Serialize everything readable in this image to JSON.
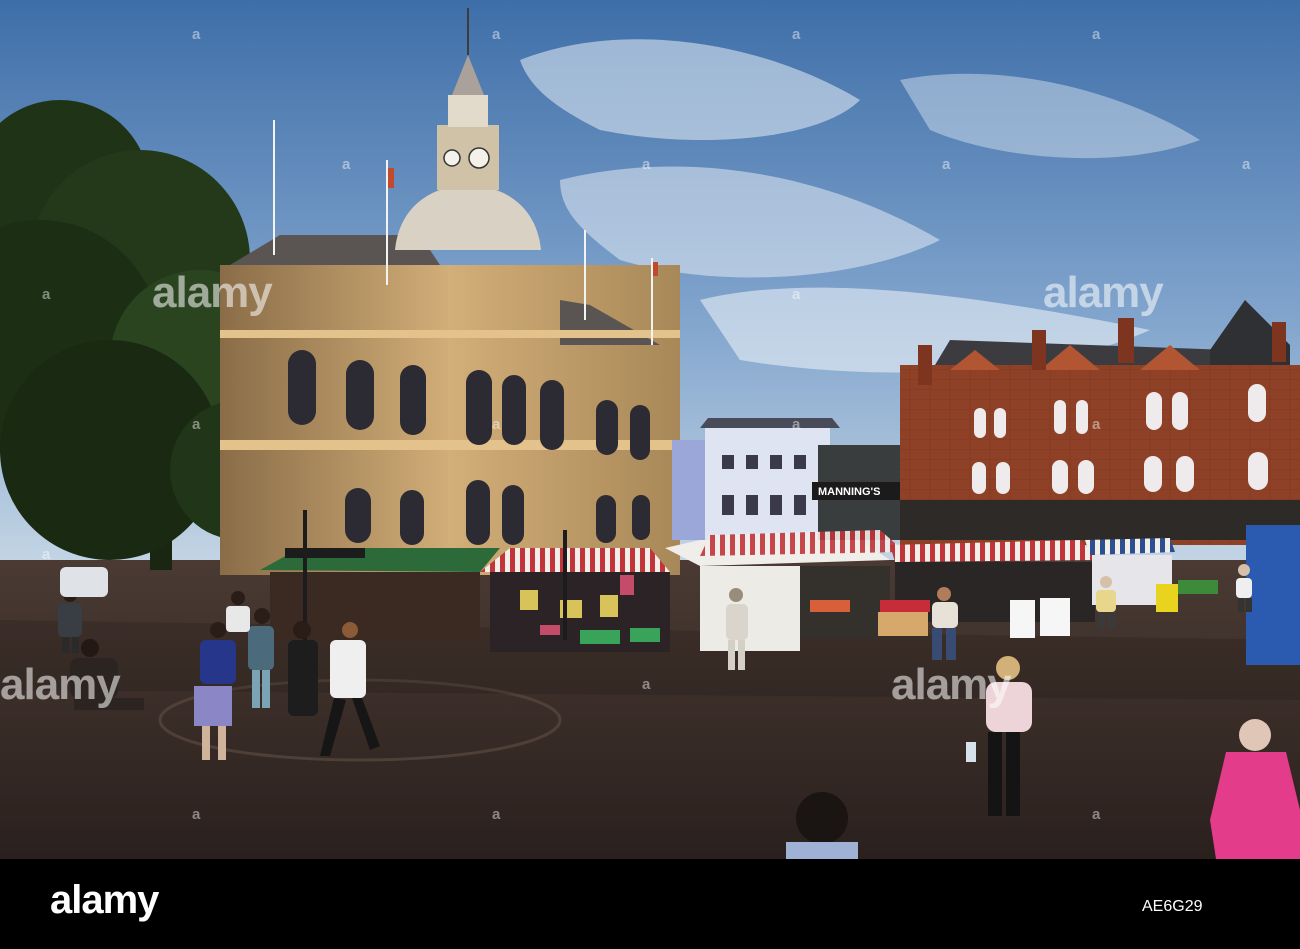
{
  "image": {
    "alt": "",
    "building_sign": "MANNING'S"
  },
  "watermarks": {
    "text": "alamy",
    "mark": "a"
  },
  "footer": {
    "logo": "alamy",
    "image_id": "AE6G29"
  },
  "colors": {
    "sky_top": "#3f6fa8",
    "sky_bottom": "#b8cde0",
    "town_hall": "#c9a46e",
    "brick": "#9a4526",
    "pavement": "#3b2e2a",
    "awning_red": "#c0343a"
  }
}
